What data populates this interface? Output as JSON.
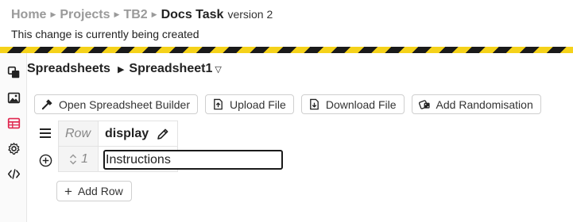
{
  "breadcrumb": {
    "items": [
      "Home",
      "Projects",
      "TB2"
    ],
    "current": "Docs Task",
    "version": "version 2"
  },
  "status_text": "This change is currently being created",
  "rail": {
    "icons": [
      "layers-icon",
      "image-icon",
      "spreadsheet-icon",
      "gear-icon",
      "code-icon"
    ],
    "active": "spreadsheet-icon"
  },
  "spreadsheet": {
    "section": "Spreadsheets",
    "name": "Spreadsheet1"
  },
  "toolbar": {
    "open_builder": "Open Spreadsheet Builder",
    "upload": "Upload File",
    "download": "Download File",
    "randomisation": "Add Randomisation"
  },
  "table": {
    "row_header": "Row",
    "column_header": "display",
    "rows": [
      {
        "number": "1",
        "display": "Instructions"
      }
    ]
  },
  "add_row_label": "Add Row",
  "colors": {
    "accent_red": "#e0264f",
    "hazard_yellow": "#f5d21a",
    "hazard_black": "#1a1a1a"
  }
}
